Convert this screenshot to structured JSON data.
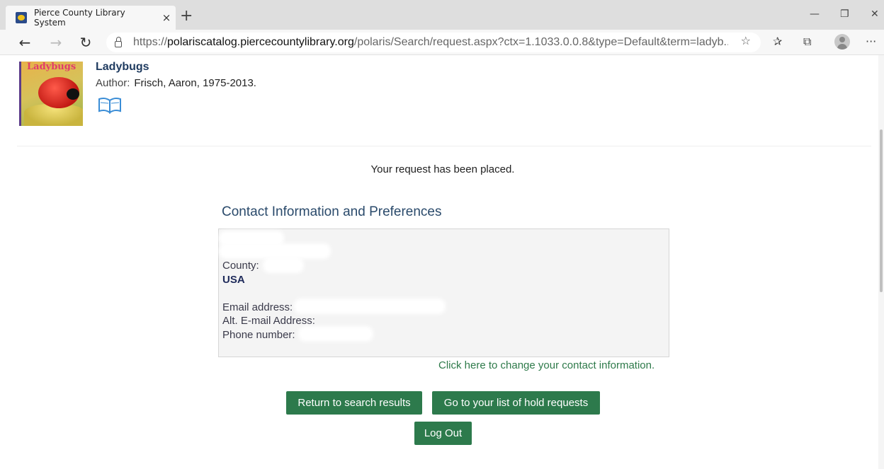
{
  "browser": {
    "tab_title": "Pierce County Library System",
    "tab_close": "×",
    "new_tab": "+",
    "minimize": "—",
    "restore": "❐",
    "close": "✕",
    "back": "←",
    "forward": "→",
    "refresh": "↻",
    "url_scheme": "https://",
    "url_host": "polariscatalog.piercecountylibrary.org",
    "url_path": "/polaris/Search/request.aspx?ctx=1.1033.0.0.8&type=Default&term=ladyb...",
    "favorite_star": "☆",
    "favorites_icon": "✰",
    "collections_icon": "⧉",
    "more_icon": "···"
  },
  "item": {
    "cover_title": "Ladybugs",
    "title": "Ladybugs",
    "author_label": "Author:",
    "author_value": "Frisch, Aaron, 1975-2013.",
    "format_icon": "book-icon"
  },
  "confirmation": "Your request has been placed.",
  "contact": {
    "heading": "Contact Information and Preferences",
    "county_label": "County:",
    "country": "USA",
    "email_label": "Email address:",
    "alt_email_label": "Alt. E-mail Address:",
    "phone_label": "Phone number:",
    "change_link": "Click here to change your contact information."
  },
  "buttons": {
    "return_label": "Return to search results",
    "holds_label": "Go to your list of hold requests",
    "logout_label": "Log Out"
  },
  "colors": {
    "button_green": "#2d7a4c",
    "heading_blue": "#2a4a6b",
    "link_green": "#2e7a4a"
  }
}
